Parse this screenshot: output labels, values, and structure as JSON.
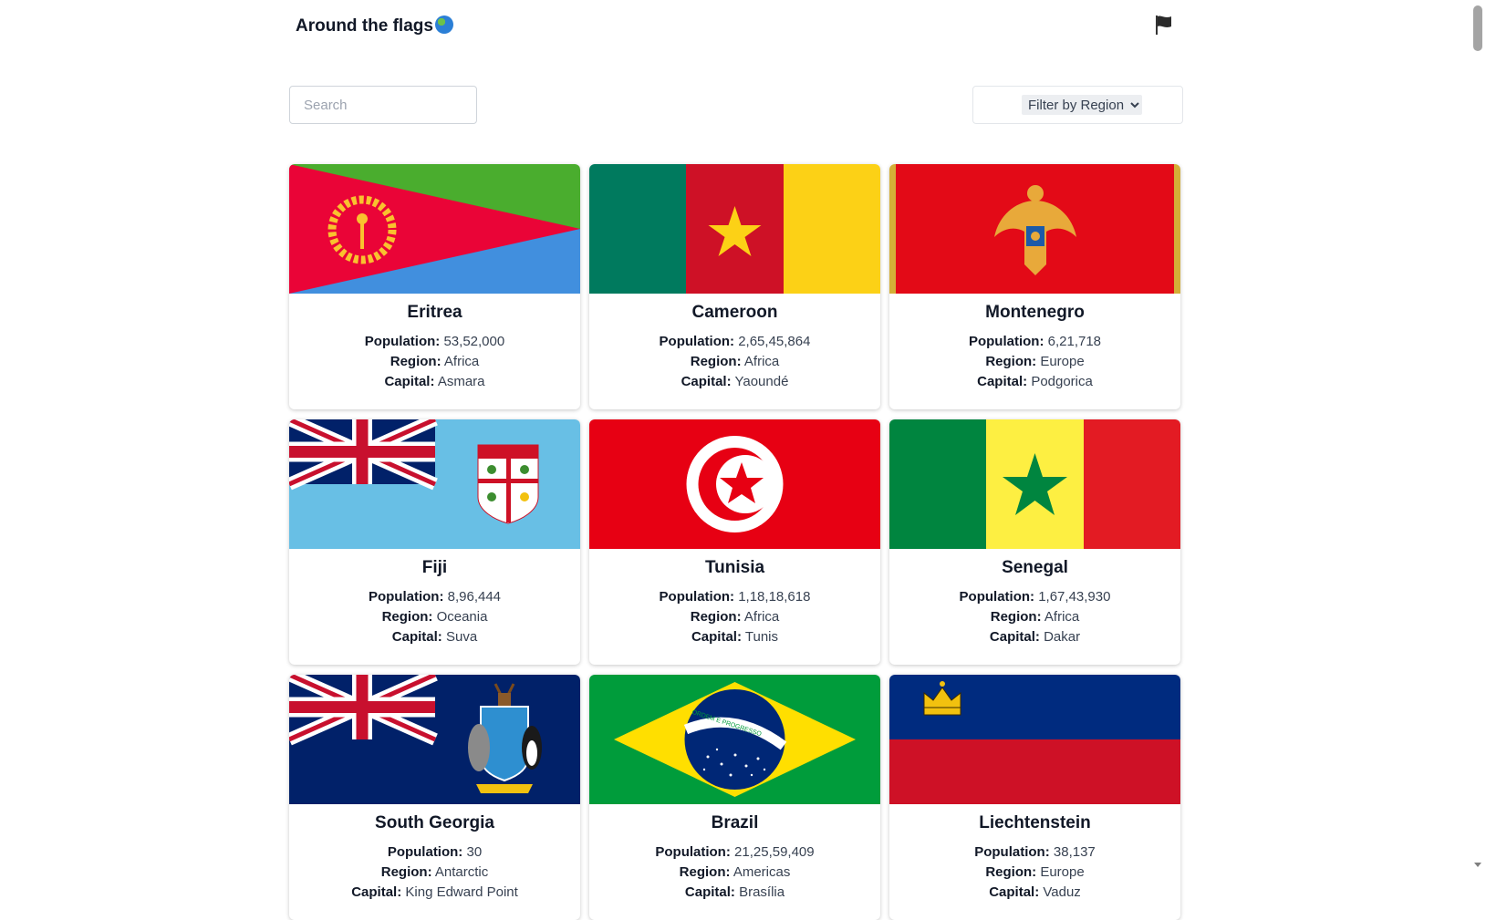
{
  "header": {
    "title": "Around the flags"
  },
  "search": {
    "placeholder": "Search"
  },
  "filter": {
    "selected": "Filter by Region"
  },
  "countries": [
    {
      "name": "Eritrea",
      "population": "53,52,000",
      "region": "Africa",
      "capital": "Asmara"
    },
    {
      "name": "Cameroon",
      "population": "2,65,45,864",
      "region": "Africa",
      "capital": "Yaoundé"
    },
    {
      "name": "Montenegro",
      "population": "6,21,718",
      "region": "Europe",
      "capital": "Podgorica"
    },
    {
      "name": "Fiji",
      "population": "8,96,444",
      "region": "Oceania",
      "capital": "Suva"
    },
    {
      "name": "Tunisia",
      "population": "1,18,18,618",
      "region": "Africa",
      "capital": "Tunis"
    },
    {
      "name": "Senegal",
      "population": "1,67,43,930",
      "region": "Africa",
      "capital": "Dakar"
    },
    {
      "name": "South Georgia",
      "population": "30",
      "region": "Antarctic",
      "capital": "King Edward Point"
    },
    {
      "name": "Brazil",
      "population": "21,25,59,409",
      "region": "Americas",
      "capital": "Brasília"
    },
    {
      "name": "Liechtenstein",
      "population": "38,137",
      "region": "Europe",
      "capital": "Vaduz"
    }
  ],
  "labels": {
    "population": "Population:",
    "region": "Region:",
    "capital": "Capital:"
  },
  "brazil_motto": "ORDEM E PROGRESSO"
}
